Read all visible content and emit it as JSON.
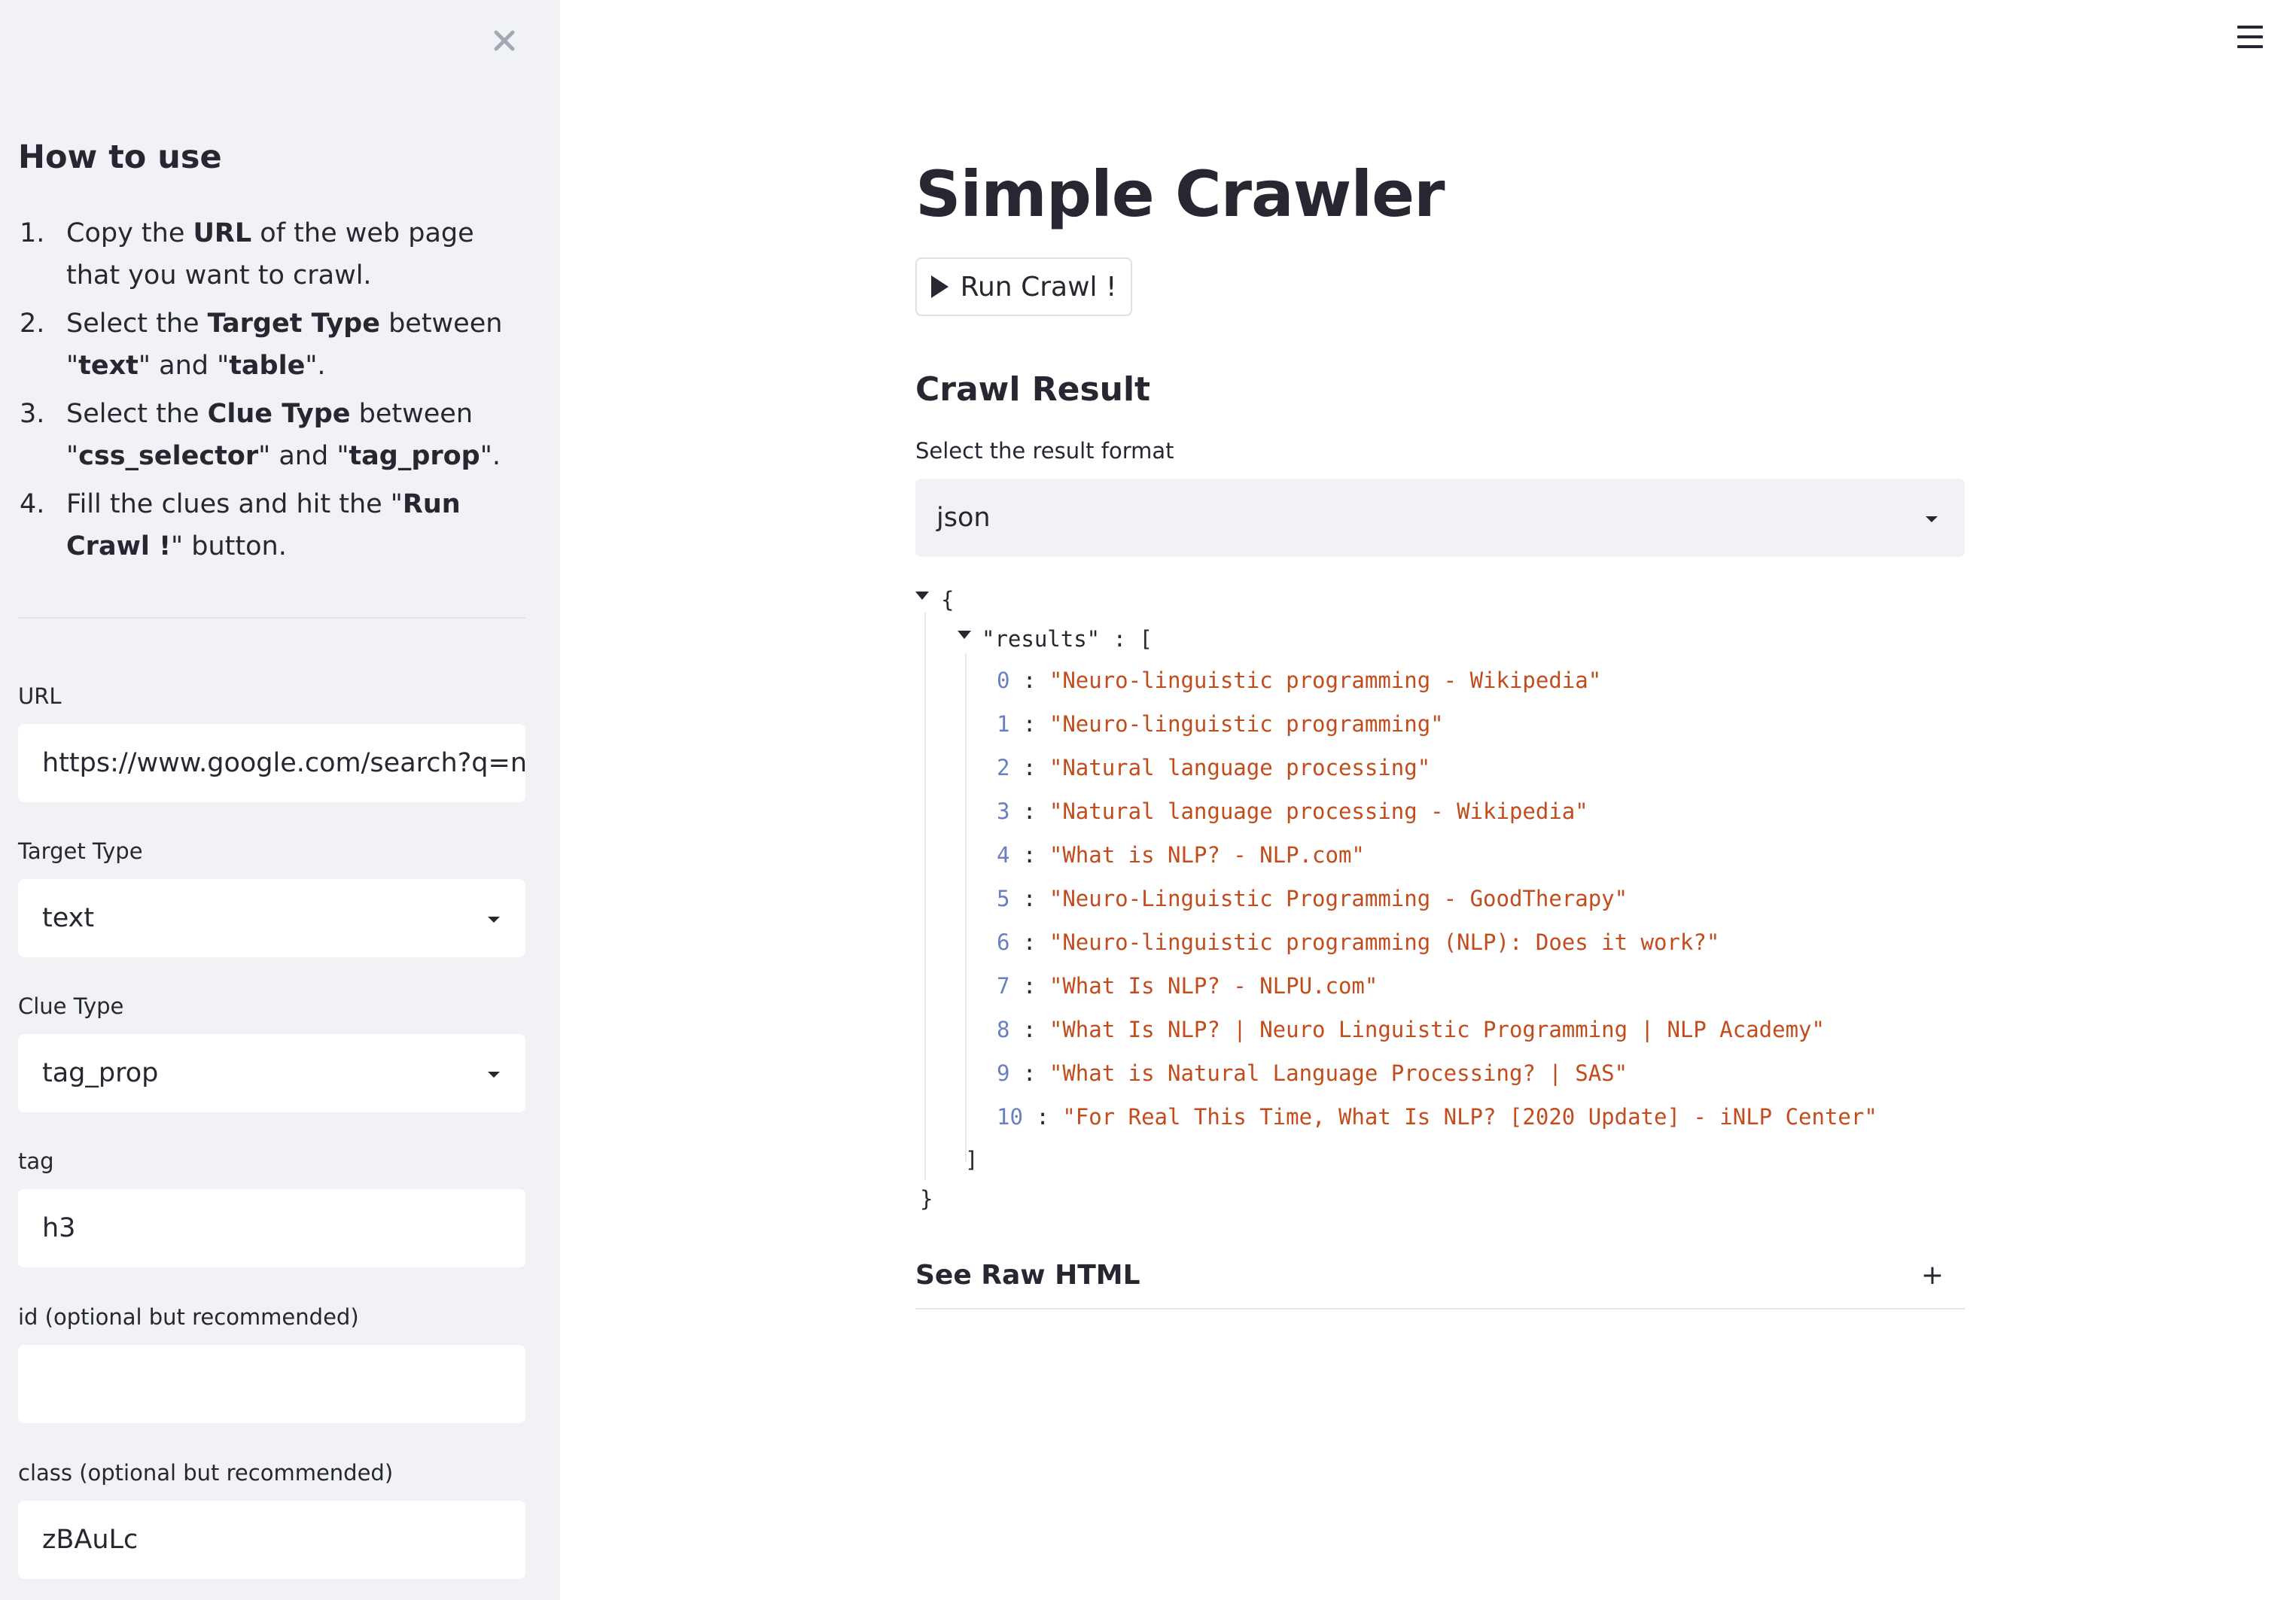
{
  "sidebar": {
    "close_icon": "close-icon",
    "heading": "How to use",
    "steps": [
      {
        "n": "1.",
        "parts": [
          "Copy the ",
          "URL",
          " of the web page that you want to crawl."
        ]
      },
      {
        "n": "2.",
        "parts": [
          "Select the ",
          "Target Type",
          " between \"",
          "text",
          "\" and \"",
          "table",
          "\"."
        ]
      },
      {
        "n": "3.",
        "parts": [
          "Select the ",
          "Clue Type",
          " between \"",
          "css_selector",
          "\" and \"",
          "tag_prop",
          "\"."
        ]
      },
      {
        "n": "4.",
        "parts": [
          "Fill the clues and hit the \"",
          "Run Crawl !",
          "\" button."
        ]
      }
    ],
    "url": {
      "label": "URL",
      "value": "https://www.google.com/search?q=nlp"
    },
    "target_type": {
      "label": "Target Type",
      "value": "text"
    },
    "clue_type": {
      "label": "Clue Type",
      "value": "tag_prop"
    },
    "tag": {
      "label": "tag",
      "value": "h3"
    },
    "id_field": {
      "label": "id (optional but recommended)",
      "value": ""
    },
    "class_field": {
      "label": "class (optional but recommended)",
      "value": "zBAuLc"
    }
  },
  "header": {
    "menu_icon": "hamburger-menu-icon"
  },
  "main": {
    "title": "Simple Crawler",
    "run_button": "Run Crawl !",
    "section_title": "Crawl Result",
    "format_label": "Select the result format",
    "format_value": "json",
    "json": {
      "open_brace": "{",
      "close_brace": "}",
      "results_key": "\"results\"",
      "key_sep": " : [",
      "close_bracket": "]",
      "sep": " : ",
      "results": [
        "\"Neuro-linguistic programming - Wikipedia\"",
        "\"Neuro-linguistic programming\"",
        "\"Natural language processing\"",
        "\"Natural language processing - Wikipedia\"",
        "\"What is NLP? - NLP.com\"",
        "\"Neuro-Linguistic Programming - GoodTherapy\"",
        "\"Neuro-linguistic programming (NLP): Does it work?\"",
        "\"What Is NLP? - NLPU.com\"",
        "\"What Is NLP? | Neuro Linguistic Programming | NLP Academy\"",
        "\"What is Natural Language Processing? | SAS\"",
        "\"For Real This Time, What Is NLP? [2020 Update] - iNLP Center\""
      ]
    },
    "expander_label": "See Raw HTML",
    "expander_icon": "+"
  },
  "colors": {
    "sidebar_bg": "#f0f2f6",
    "text": "#262730",
    "json_string": "#c24c1c",
    "json_index": "#6a7fc1"
  }
}
